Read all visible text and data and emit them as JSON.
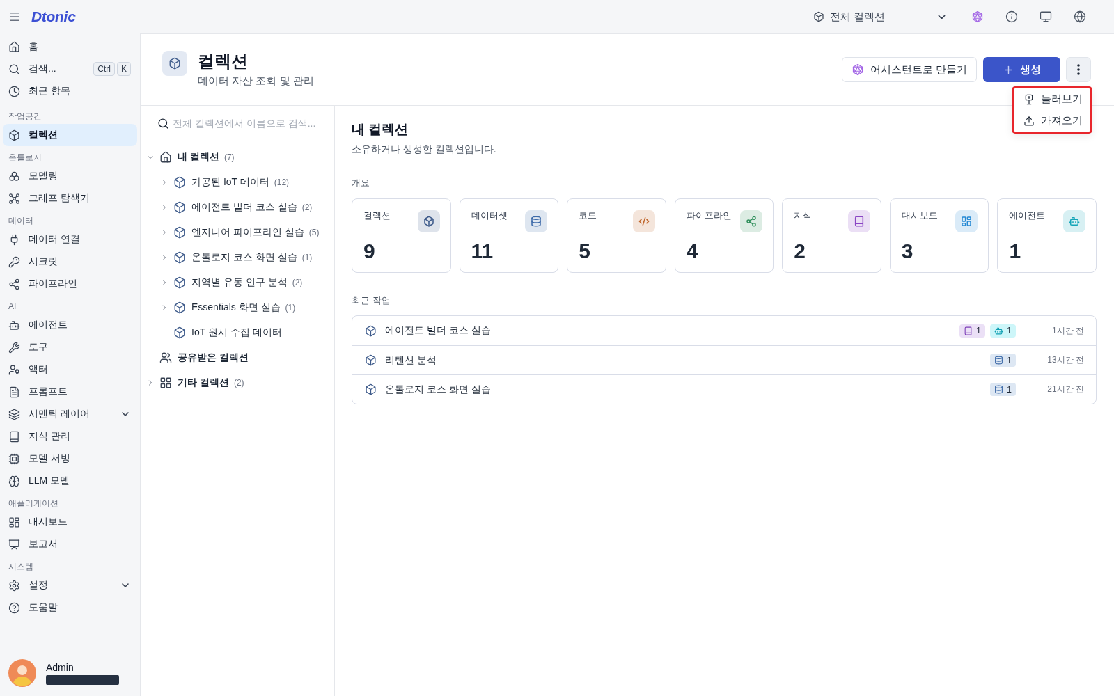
{
  "top_bar": {
    "logo": "Dtonic",
    "collection_selector": {
      "label": "전체 컬렉션"
    }
  },
  "sidebar": {
    "items": [
      {
        "label": "홈",
        "kind": "link",
        "selected": false
      },
      {
        "label": "검색...",
        "kind": "link",
        "selected": false,
        "shortcut": [
          "Ctrl",
          "K"
        ]
      },
      {
        "label": "최근 항목",
        "kind": "link",
        "selected": false
      }
    ],
    "sections": [
      {
        "label": "작업공간",
        "items": [
          {
            "label": "컬렉션",
            "kind": "link",
            "selected": true
          }
        ]
      },
      {
        "label": "온톨로지",
        "items": [
          {
            "label": "모델링",
            "kind": "link",
            "selected": false
          },
          {
            "label": "그래프 탐색기",
            "kind": "link",
            "selected": false
          }
        ]
      },
      {
        "label": "데이터",
        "items": [
          {
            "label": "데이터 연결",
            "kind": "link",
            "selected": false
          },
          {
            "label": "시크릿",
            "kind": "link",
            "selected": false
          },
          {
            "label": "파이프라인",
            "kind": "link",
            "selected": false
          }
        ]
      },
      {
        "label": "AI",
        "items": [
          {
            "label": "에이전트",
            "kind": "link",
            "selected": false
          },
          {
            "label": "도구",
            "kind": "link",
            "selected": false
          },
          {
            "label": "액터",
            "kind": "link",
            "selected": false
          },
          {
            "label": "프롬프트",
            "kind": "link",
            "selected": false
          },
          {
            "label": "시맨틱 레이어",
            "kind": "group",
            "selected": false
          },
          {
            "label": "지식 관리",
            "kind": "link",
            "selected": false
          },
          {
            "label": "모델 서빙",
            "kind": "link",
            "selected": false
          },
          {
            "label": "LLM 모델",
            "kind": "link",
            "selected": false
          }
        ]
      },
      {
        "label": "애플리케이션",
        "items": [
          {
            "label": "대시보드",
            "kind": "link",
            "selected": false
          },
          {
            "label": "보고서",
            "kind": "link",
            "selected": false
          }
        ]
      },
      {
        "label": "시스템",
        "items": [
          {
            "label": "설정",
            "kind": "group",
            "selected": false
          },
          {
            "label": "도움말",
            "kind": "link",
            "selected": false
          }
        ]
      }
    ],
    "user": {
      "name": "Admin"
    }
  },
  "header": {
    "title": "컬렉션",
    "subtitle": "데이터 자산 조회 및 관리",
    "buttons": [
      {
        "label": "어시스턴트로 만들기",
        "kind": "secondary"
      },
      {
        "label": "생성",
        "kind": "primary"
      }
    ],
    "more_menu": {
      "open": true,
      "items": [
        {
          "label": "둘러보기"
        },
        {
          "label": "가져오기"
        }
      ]
    }
  },
  "tree": {
    "search": {
      "placeholder": "전체 컬렉션에서 이름으로 검색..."
    },
    "nodes": [
      {
        "label": "내 컬렉션",
        "count": "(7)",
        "kind": "group",
        "expanded": true,
        "children": [
          {
            "label": "가공된 IoT 데이터",
            "count": "(12)",
            "kind": "group",
            "expanded": false
          },
          {
            "label": "에이전트 빌더 코스 실습",
            "count": "(2)",
            "kind": "group",
            "expanded": false
          },
          {
            "label": "엔지니어 파이프라인 실습",
            "count": "(5)",
            "kind": "group",
            "expanded": false
          },
          {
            "label": "온톨로지 코스 화면 실습",
            "count": "(1)",
            "kind": "group",
            "expanded": false
          },
          {
            "label": "지역별 유동 인구 분석",
            "count": "(2)",
            "kind": "group",
            "expanded": false
          },
          {
            "label": "Essentials 화면 실습",
            "count": "(1)",
            "kind": "group",
            "expanded": false
          },
          {
            "label": "IoT 원시 수집 데이터",
            "kind": "leaf"
          }
        ]
      },
      {
        "label": "공유받은 컬렉션",
        "kind": "leaf"
      },
      {
        "label": "기타 컬렉션",
        "count": "(2)",
        "kind": "group",
        "expanded": false
      }
    ]
  },
  "content": {
    "title": "내 컬렉션",
    "subtitle": "소유하거나 생성한 컬렉션입니다.",
    "overview": {
      "label": "개요",
      "stats": [
        {
          "label": "컬렉션",
          "value": "9",
          "kind": "collection",
          "color": "#3d5a8a"
        },
        {
          "label": "데이터셋",
          "value": "11",
          "kind": "dataset",
          "color": "#3d6aa8"
        },
        {
          "label": "코드",
          "value": "5",
          "kind": "code",
          "color": "#c0652a"
        },
        {
          "label": "파이프라인",
          "value": "4",
          "kind": "pipeline",
          "color": "#2f8f5b"
        },
        {
          "label": "지식",
          "value": "2",
          "kind": "knowledge",
          "color": "#8a45c4"
        },
        {
          "label": "대시보드",
          "value": "3",
          "kind": "dashboard",
          "color": "#2589d4"
        },
        {
          "label": "에이전트",
          "value": "1",
          "kind": "agent",
          "color": "#14a5b8"
        }
      ]
    },
    "recent": {
      "label": "최근 작업",
      "items": [
        {
          "title": "에이전트 빌더 코스 실습",
          "badges": [
            {
              "kind": "knowledge",
              "count": "1"
            },
            {
              "kind": "agent",
              "count": "1"
            }
          ],
          "time": "1시간 전"
        },
        {
          "title": "리텐션 분석",
          "badges": [
            {
              "kind": "dataset",
              "count": "1"
            }
          ],
          "time": "13시간 전"
        },
        {
          "title": "온톨로지 코스 화면 실습",
          "badges": [
            {
              "kind": "dataset",
              "count": "1"
            }
          ],
          "time": "21시간 전"
        }
      ]
    }
  }
}
